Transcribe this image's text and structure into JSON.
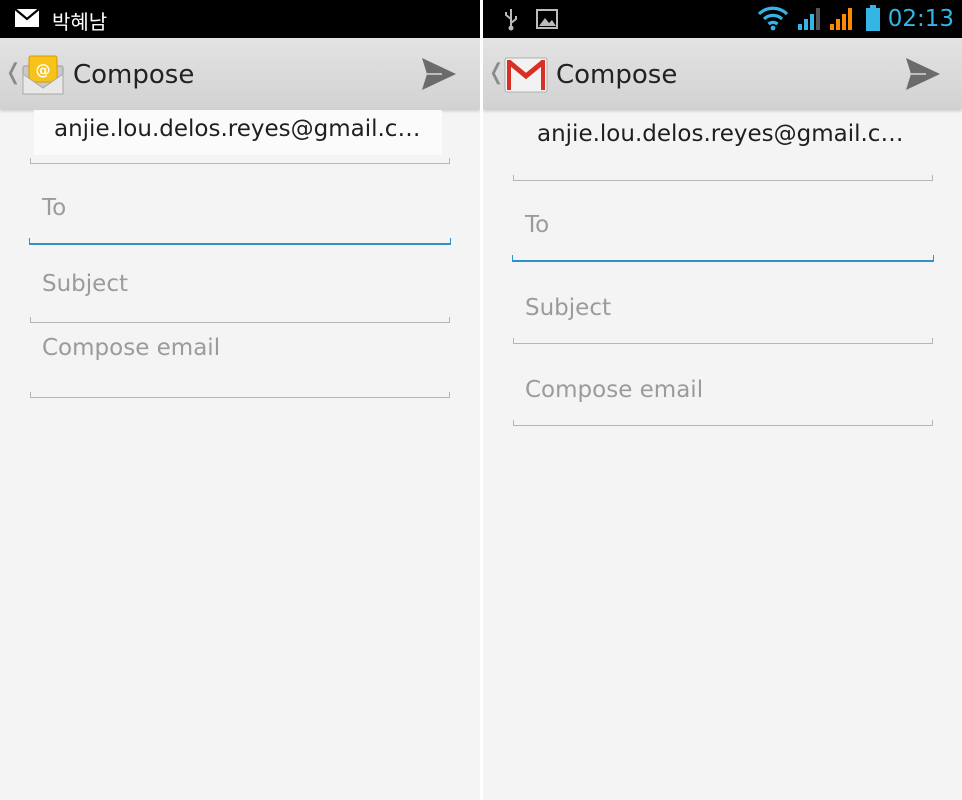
{
  "left": {
    "status": {
      "carrier_label": "박혜남",
      "notification_icon": "envelope-icon"
    },
    "actionbar": {
      "title": "Compose",
      "app_icon": "email-app-icon",
      "send_icon": "send-icon"
    },
    "compose": {
      "from_value": "anjie.lou.delos.reyes@gmail.c…",
      "to_placeholder": "To",
      "subject_placeholder": "Subject",
      "body_placeholder": "Compose email"
    }
  },
  "right": {
    "status": {
      "clock": "02:13",
      "icons": [
        "usb-icon",
        "image-icon",
        "wifi-icon",
        "signal-icon",
        "signal-icon",
        "battery-icon"
      ]
    },
    "actionbar": {
      "title": "Compose",
      "app_icon": "gmail-icon",
      "send_icon": "send-icon"
    },
    "compose": {
      "from_value": "anjie.lou.delos.reyes@gmail.c…",
      "to_placeholder": "To",
      "subject_placeholder": "Subject",
      "body_placeholder": "Compose email"
    }
  },
  "colors": {
    "accent": "#33b5e5",
    "focus_line": "#2e92c8",
    "gmail_red": "#d93025",
    "signal_orange": "#ff8a00"
  }
}
